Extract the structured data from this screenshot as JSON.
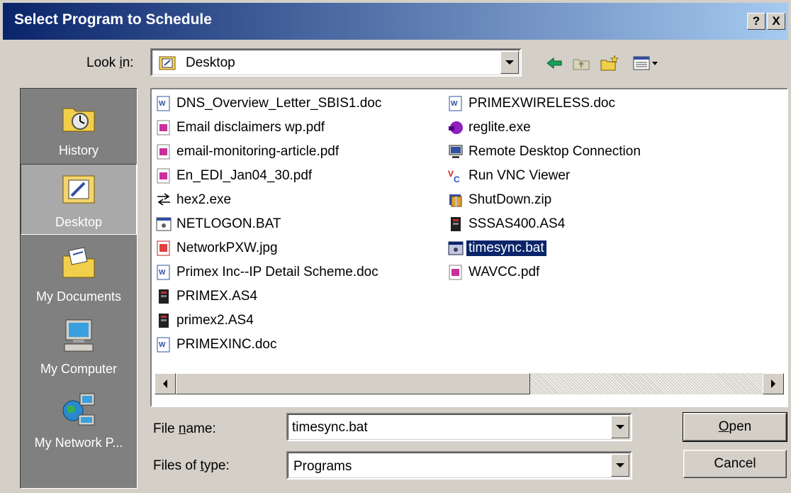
{
  "window": {
    "title": "Select Program to Schedule",
    "help_label": "?",
    "close_label": "X"
  },
  "lookin": {
    "label_pre": "Look ",
    "label_ul": "i",
    "label_post": "n:",
    "value": "Desktop"
  },
  "places": [
    {
      "label": "History",
      "icon": "history-folder-icon"
    },
    {
      "label": "Desktop",
      "icon": "desktop-icon",
      "active": true
    },
    {
      "label": "My Documents",
      "icon": "my-documents-folder-icon"
    },
    {
      "label": "My Computer",
      "icon": "my-computer-icon"
    },
    {
      "label": "My Network P...",
      "icon": "my-network-places-icon"
    }
  ],
  "files_col1": [
    {
      "name": "DNS_Overview_Letter_SBIS1.doc",
      "icon": "word-doc-icon"
    },
    {
      "name": "Email disclaimers wp.pdf",
      "icon": "pdf-icon"
    },
    {
      "name": "email-monitoring-article.pdf",
      "icon": "pdf-icon"
    },
    {
      "name": "En_EDI_Jan04_30.pdf",
      "icon": "pdf-icon"
    },
    {
      "name": "hex2.exe",
      "icon": "exe-icon"
    },
    {
      "name": "NETLOGON.BAT",
      "icon": "batch-icon"
    },
    {
      "name": "NetworkPXW.jpg",
      "icon": "image-icon"
    },
    {
      "name": "Primex Inc--IP Detail Scheme.doc",
      "icon": "word-doc-icon"
    },
    {
      "name": "PRIMEX.AS4",
      "icon": "as4-icon"
    },
    {
      "name": "primex2.AS4",
      "icon": "as4-icon"
    },
    {
      "name": "PRIMEXINC.doc",
      "icon": "word-doc-icon"
    }
  ],
  "files_col2": [
    {
      "name": "PRIMEXWIRELESS.doc",
      "icon": "word-doc-icon"
    },
    {
      "name": "reglite.exe",
      "icon": "reglite-icon"
    },
    {
      "name": "Remote Desktop Connection",
      "icon": "remote-desktop-icon"
    },
    {
      "name": "Run VNC Viewer",
      "icon": "vnc-icon"
    },
    {
      "name": "ShutDown.zip",
      "icon": "zip-icon"
    },
    {
      "name": "SSSAS400.AS4",
      "icon": "as4-icon"
    },
    {
      "name": "timesync.bat",
      "icon": "batch-icon",
      "selected": true
    },
    {
      "name": "WAVCC.pdf",
      "icon": "pdf-icon"
    }
  ],
  "filename": {
    "label_pre": "File ",
    "label_ul": "n",
    "label_post": "ame:",
    "value": "timesync.bat"
  },
  "filetype": {
    "label_pre": "Files of ",
    "label_ul": "t",
    "label_post": "ype:",
    "value": "Programs"
  },
  "buttons": {
    "open_ul": "O",
    "open_rest": "pen",
    "cancel": "Cancel"
  },
  "colors": {
    "title_start": "#0a246a",
    "title_end": "#a6caf0",
    "selection": "#0a246a",
    "dialog": "#d4d0c8"
  }
}
